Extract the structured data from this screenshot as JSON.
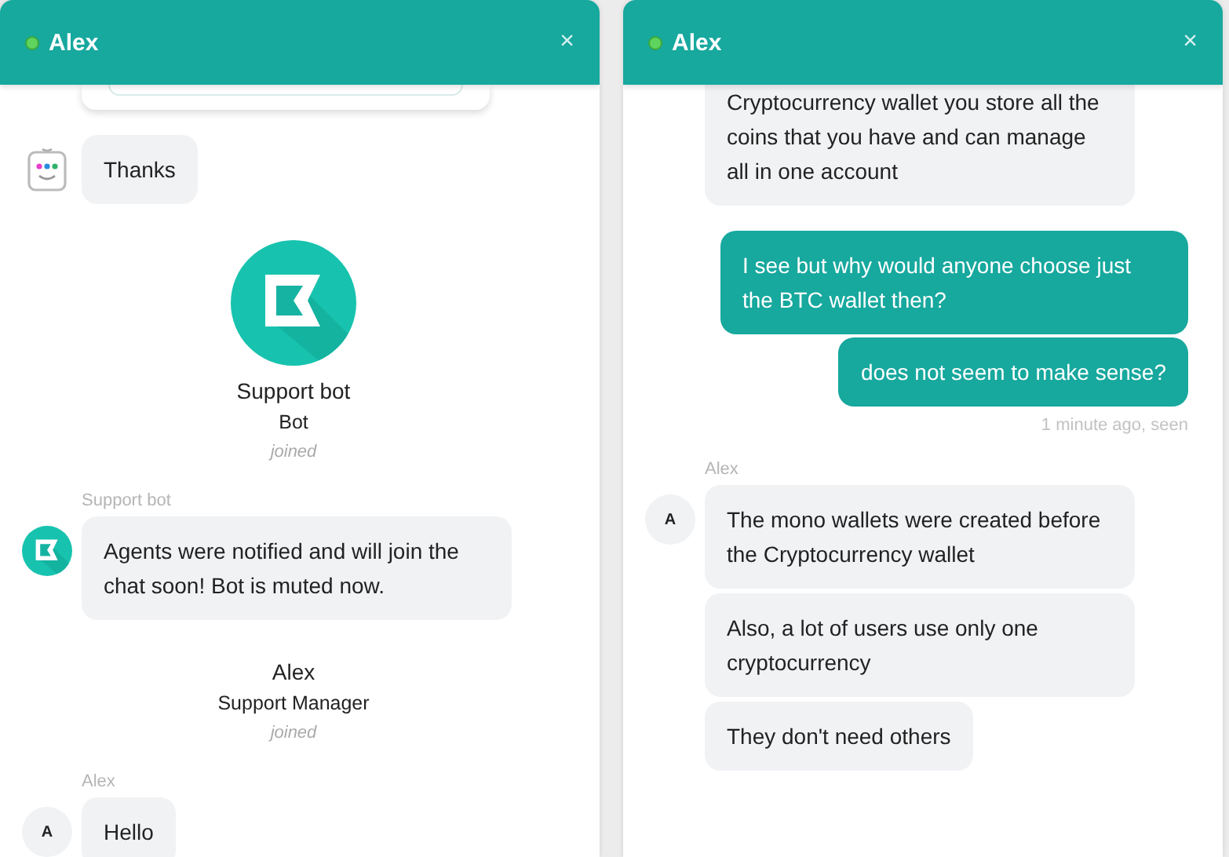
{
  "windows": [
    {
      "title": "Alex",
      "online": true,
      "close": "×",
      "messages": [
        {
          "kind": "card"
        },
        {
          "kind": "incoming",
          "avatar": {
            "kind": "robot"
          },
          "bubbles": [
            "Thanks"
          ]
        },
        {
          "kind": "joined",
          "avatar": {
            "kind": "bot"
          },
          "name": "Support bot",
          "role": "Bot",
          "status": "joined"
        },
        {
          "kind": "incoming",
          "sender": "Support bot",
          "avatar": {
            "kind": "bot"
          },
          "bubbles": [
            "Agents were notified and will join the chat soon! Bot is muted now."
          ]
        },
        {
          "kind": "joined",
          "name": "Alex",
          "role": "Support Manager",
          "status": "joined"
        },
        {
          "kind": "incoming",
          "sender": "Alex",
          "avatar": {
            "kind": "initial",
            "text": "A"
          },
          "bubbles": [
            "Hello"
          ]
        }
      ]
    },
    {
      "title": "Alex",
      "online": true,
      "close": "×",
      "messages": [
        {
          "kind": "incoming",
          "bubbles": [
            "Cryptocurrency wallet you store all the coins that you have and can manage all in one account"
          ]
        },
        {
          "kind": "outgoing",
          "bubbles": [
            "I see but why would anyone choose just the BTC wallet then?",
            "does not seem to make sense?"
          ]
        },
        {
          "kind": "receipt",
          "text": "1 minute ago, seen"
        },
        {
          "kind": "incoming",
          "sender": "Alex",
          "avatar": {
            "kind": "initial",
            "text": "A"
          },
          "bubbles": [
            "The mono wallets were created before the Cryptocurrency wallet",
            "Also, a lot of users use only one cryptocurrency",
            "They don't need others"
          ]
        }
      ]
    }
  ]
}
